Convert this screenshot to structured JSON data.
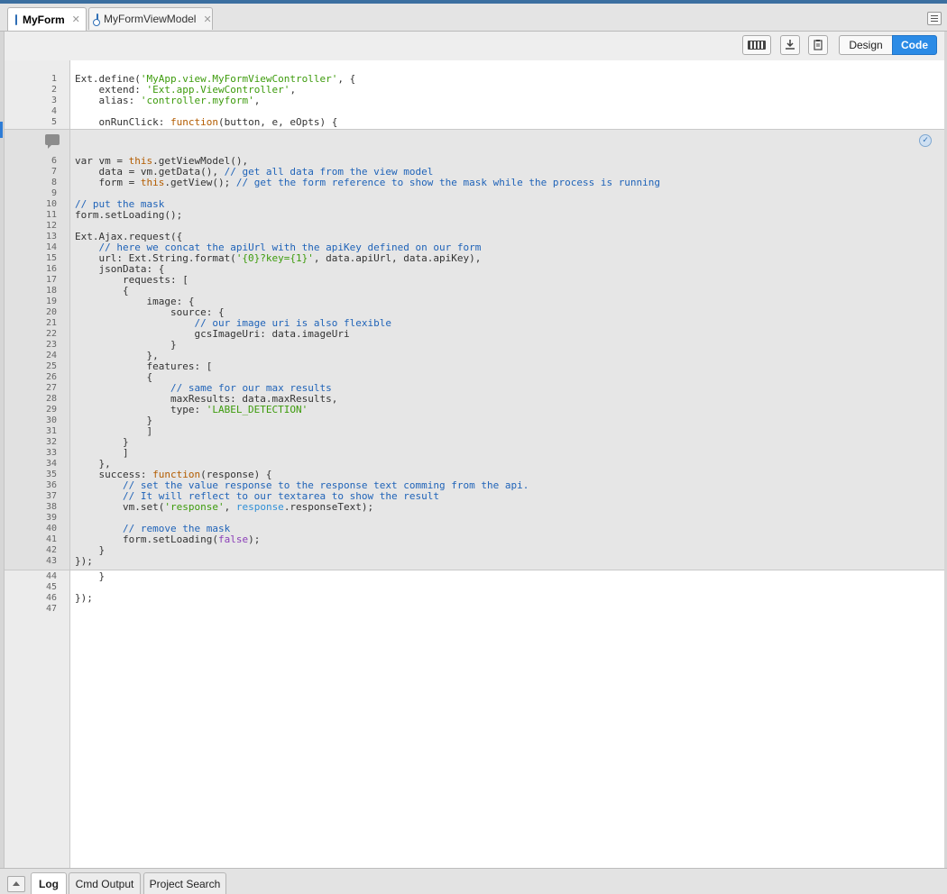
{
  "tabs": [
    {
      "label": "MyForm",
      "icon": "form-icon",
      "active": true
    },
    {
      "label": "MyFormViewModel",
      "icon": "viewmodel-icon",
      "active": false
    }
  ],
  "toolbar": {
    "design_label": "Design",
    "code_label": "Code",
    "active_mode": "Code",
    "accent": "#2b8be6"
  },
  "editor": {
    "lines_top": [
      {
        "n": "1",
        "html": "Ext.define(<span class=\"s\">'MyApp.view.MyFormViewController'</span>, {"
      },
      {
        "n": "2",
        "html": "    extend: <span class=\"s\">'Ext.app.ViewController'</span>,"
      },
      {
        "n": "3",
        "html": "    alias: <span class=\"s\">'controller.myform'</span>,"
      },
      {
        "n": "4",
        "html": ""
      },
      {
        "n": "5",
        "html": "    onRunClick: <span class=\"k\">function</span>(button, e, eOpts) {"
      }
    ],
    "lines_region": [
      {
        "n": "6",
        "html": "var vm = <span class=\"k\">this</span>.getViewModel(),"
      },
      {
        "n": "7",
        "html": "    data = vm.getData(), <span class=\"c\">// get all data from the view model</span>"
      },
      {
        "n": "8",
        "html": "    form = <span class=\"k\">this</span>.getView(); <span class=\"c\">// get the form reference to show the mask while the process is running</span>"
      },
      {
        "n": "9",
        "html": ""
      },
      {
        "n": "10",
        "html": "<span class=\"c\">// put the mask</span>"
      },
      {
        "n": "11",
        "html": "form.setLoading();"
      },
      {
        "n": "12",
        "html": ""
      },
      {
        "n": "13",
        "html": "Ext.Ajax.request({"
      },
      {
        "n": "14",
        "html": "    <span class=\"c\">// here we concat the apiUrl with the apiKey defined on our form</span>"
      },
      {
        "n": "15",
        "html": "    url: Ext.String.format(<span class=\"s\">'{0}?key={1}'</span>, data.apiUrl, data.apiKey),"
      },
      {
        "n": "16",
        "html": "    jsonData: {"
      },
      {
        "n": "17",
        "html": "        requests: ["
      },
      {
        "n": "18",
        "html": "        {"
      },
      {
        "n": "19",
        "html": "            image: {"
      },
      {
        "n": "20",
        "html": "                source: {"
      },
      {
        "n": "21",
        "html": "                    <span class=\"c\">// our image uri is also flexible</span>"
      },
      {
        "n": "22",
        "html": "                    gcsImageUri: data.imageUri"
      },
      {
        "n": "23",
        "html": "                }"
      },
      {
        "n": "24",
        "html": "            },"
      },
      {
        "n": "25",
        "html": "            features: ["
      },
      {
        "n": "26",
        "html": "            {"
      },
      {
        "n": "27",
        "html": "                <span class=\"c\">// same for our max results</span>"
      },
      {
        "n": "28",
        "html": "                maxResults: data.maxResults,"
      },
      {
        "n": "29",
        "html": "                type: <span class=\"s\">'LABEL_DETECTION'</span>"
      },
      {
        "n": "30",
        "html": "            }"
      },
      {
        "n": "31",
        "html": "            ]"
      },
      {
        "n": "32",
        "html": "        }"
      },
      {
        "n": "33",
        "html": "        ]"
      },
      {
        "n": "34",
        "html": "    },"
      },
      {
        "n": "35",
        "html": "    success: <span class=\"k\">function</span>(response) {"
      },
      {
        "n": "36",
        "html": "        <span class=\"c\">// set the value response to the response text comming from the api.</span>"
      },
      {
        "n": "37",
        "html": "        <span class=\"c\">// It will reflect to our textarea to show the result</span>"
      },
      {
        "n": "38",
        "html": "        vm.set(<span class=\"s\">'response'</span>, <span class=\"bl\">response</span>.responseText);"
      },
      {
        "n": "39",
        "html": ""
      },
      {
        "n": "40",
        "html": "        <span class=\"c\">// remove the mask</span>"
      },
      {
        "n": "41",
        "html": "        form.setLoading(<span class=\"p\">false</span>);"
      },
      {
        "n": "42",
        "html": "    }"
      },
      {
        "n": "43",
        "html": "});"
      }
    ],
    "lines_bottom": [
      {
        "n": "44",
        "html": "    }"
      },
      {
        "n": "45",
        "html": ""
      },
      {
        "n": "46",
        "html": "});"
      },
      {
        "n": "47",
        "html": ""
      }
    ]
  },
  "bottom_tabs": [
    {
      "label": "Log",
      "active": true
    },
    {
      "label": "Cmd Output",
      "active": false
    },
    {
      "label": "Project Search",
      "active": false
    }
  ]
}
